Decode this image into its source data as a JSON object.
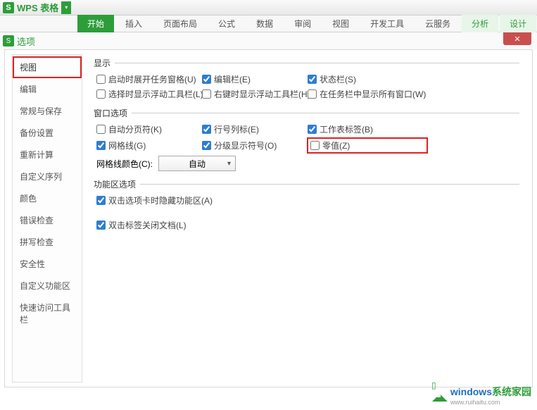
{
  "app": {
    "icon": "S",
    "title": "WPS 表格"
  },
  "ribbon": {
    "tabs": [
      {
        "label": "开始",
        "active": true
      },
      {
        "label": "插入"
      },
      {
        "label": "页面布局"
      },
      {
        "label": "公式"
      },
      {
        "label": "数据"
      },
      {
        "label": "审阅"
      },
      {
        "label": "视图"
      },
      {
        "label": "开发工具"
      },
      {
        "label": "云服务"
      },
      {
        "label": "分析",
        "highlight": true
      },
      {
        "label": "设计",
        "highlight": true
      }
    ]
  },
  "dialog": {
    "icon": "S",
    "title": "选项",
    "close": "✕"
  },
  "sidebar": {
    "items": [
      "视图",
      "编辑",
      "常规与保存",
      "备份设置",
      "重新计算",
      "自定义序列",
      "颜色",
      "错误检查",
      "拼写检查",
      "安全性",
      "自定义功能区",
      "快速访问工具栏"
    ]
  },
  "groups": {
    "display": {
      "title": "显示",
      "items": {
        "startup_pane": "启动时展开任务窗格(U)",
        "edit_bar": "编辑栏(E)",
        "status_bar": "状态栏(S)",
        "select_float": "选择时显示浮动工具栏(L)",
        "rclick_float": "右键时显示浮动工具栏(H)",
        "taskbar_all": "在任务栏中显示所有窗口(W)"
      }
    },
    "window": {
      "title": "窗口选项",
      "items": {
        "auto_page": "自动分页符(K)",
        "row_col": "行号列标(E)",
        "sheet_tab": "工作表标签(B)",
        "gridlines": "网格线(G)",
        "outline": "分级显示符号(O)",
        "zero": "零值(Z)"
      },
      "grid_color_label": "网格线颜色(C):",
      "grid_color_value": "自动"
    },
    "ribbon_opt": {
      "title": "功能区选项",
      "items": {
        "dbl_hide": "双击选项卡时隐藏功能区(A)",
        "dbl_close": "双击标签关闭文档(L)"
      }
    }
  },
  "watermark": {
    "blue": "windows",
    "green": "系统家园",
    "sub": "www.ruihaitu.com"
  }
}
